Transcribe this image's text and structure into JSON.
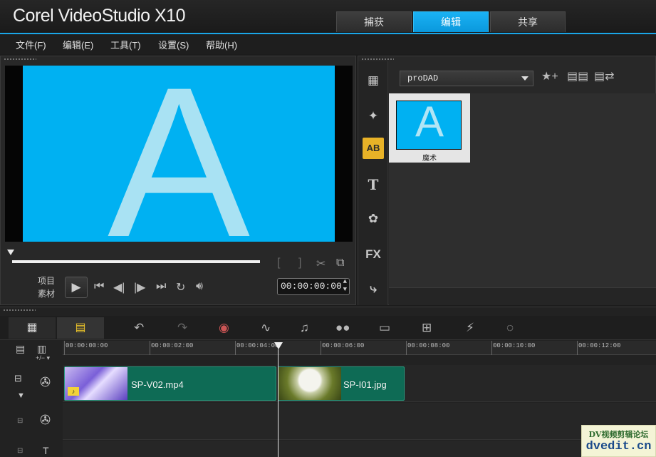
{
  "app": {
    "title": "Corel VideoStudio X10"
  },
  "tabs": [
    {
      "label": "捕获"
    },
    {
      "label": "编辑",
      "active": true
    },
    {
      "label": "共享"
    }
  ],
  "menu": [
    "文件(F)",
    "编辑(E)",
    "工具(T)",
    "设置(S)",
    "帮助(H)"
  ],
  "preview": {
    "letter": "A",
    "mode_project": "项目",
    "mode_clip": "素材",
    "timecode": "00:00:00:00"
  },
  "library": {
    "dropdown_value": "proDAD",
    "items": [
      {
        "label": "魔术",
        "letter": "A"
      }
    ]
  },
  "timeline": {
    "ruler_ticks": [
      "00:00:00:00",
      "00:00:02:00",
      "00:00:04:00",
      "00:00:06:00",
      "00:00:08:00",
      "00:00:10:00",
      "00:00:12:00"
    ],
    "zoom_label": "+/−",
    "clips": [
      {
        "name": "SP-V02.mp4"
      },
      {
        "name": "SP-I01.jpg"
      }
    ]
  },
  "watermark": {
    "line1": "DV视频剪辑论坛",
    "line2": "dvedit.cn"
  },
  "colors": {
    "accent": "#1aa6e8",
    "preview_bg": "#00b1f2",
    "clip_bg": "#0e6b55",
    "active_icon": "#e8b227"
  }
}
